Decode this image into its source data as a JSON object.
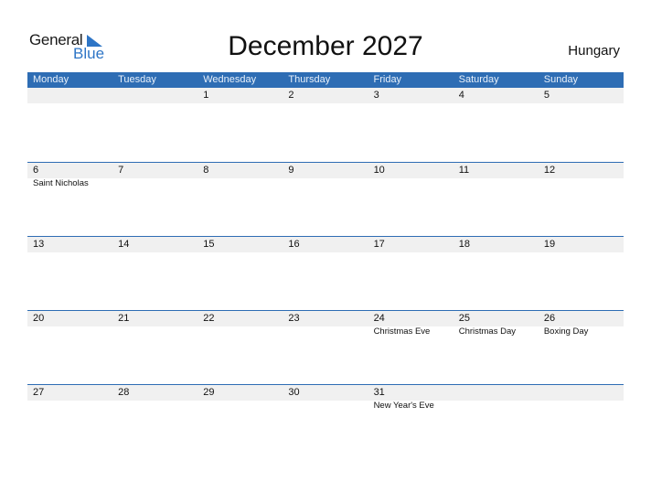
{
  "logo": {
    "general": "General",
    "blue": "Blue"
  },
  "title": "December 2027",
  "country": "Hungary",
  "colors": {
    "accent": "#2e6db4",
    "band": "#f0f0f0"
  },
  "weekdays": [
    "Monday",
    "Tuesday",
    "Wednesday",
    "Thursday",
    "Friday",
    "Saturday",
    "Sunday"
  ],
  "weeks": [
    [
      {
        "day": "",
        "holiday": ""
      },
      {
        "day": "",
        "holiday": ""
      },
      {
        "day": "1",
        "holiday": ""
      },
      {
        "day": "2",
        "holiday": ""
      },
      {
        "day": "3",
        "holiday": ""
      },
      {
        "day": "4",
        "holiday": ""
      },
      {
        "day": "5",
        "holiday": ""
      }
    ],
    [
      {
        "day": "6",
        "holiday": "Saint Nicholas"
      },
      {
        "day": "7",
        "holiday": ""
      },
      {
        "day": "8",
        "holiday": ""
      },
      {
        "day": "9",
        "holiday": ""
      },
      {
        "day": "10",
        "holiday": ""
      },
      {
        "day": "11",
        "holiday": ""
      },
      {
        "day": "12",
        "holiday": ""
      }
    ],
    [
      {
        "day": "13",
        "holiday": ""
      },
      {
        "day": "14",
        "holiday": ""
      },
      {
        "day": "15",
        "holiday": ""
      },
      {
        "day": "16",
        "holiday": ""
      },
      {
        "day": "17",
        "holiday": ""
      },
      {
        "day": "18",
        "holiday": ""
      },
      {
        "day": "19",
        "holiday": ""
      }
    ],
    [
      {
        "day": "20",
        "holiday": ""
      },
      {
        "day": "21",
        "holiday": ""
      },
      {
        "day": "22",
        "holiday": ""
      },
      {
        "day": "23",
        "holiday": ""
      },
      {
        "day": "24",
        "holiday": "Christmas Eve"
      },
      {
        "day": "25",
        "holiday": "Christmas Day"
      },
      {
        "day": "26",
        "holiday": "Boxing Day"
      }
    ],
    [
      {
        "day": "27",
        "holiday": ""
      },
      {
        "day": "28",
        "holiday": ""
      },
      {
        "day": "29",
        "holiday": ""
      },
      {
        "day": "30",
        "holiday": ""
      },
      {
        "day": "31",
        "holiday": "New Year's Eve"
      },
      {
        "day": "",
        "holiday": ""
      },
      {
        "day": "",
        "holiday": ""
      }
    ]
  ]
}
